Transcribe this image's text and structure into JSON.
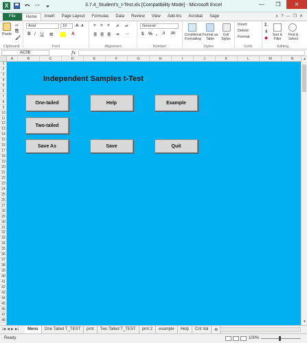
{
  "window": {
    "title": "3.7.4_Student's_t-Test.xls  [Compatibility Mode] - Microsoft Excel",
    "controls": {
      "minimize": "—",
      "maximize": "❐",
      "close": "✕"
    }
  },
  "ribbon": {
    "tabs": [
      "File",
      "Home",
      "Insert",
      "Page Layout",
      "Formulas",
      "Data",
      "Review",
      "View",
      "Add-Ins",
      "Acrobat",
      "Sage"
    ],
    "active_tab": "Home",
    "groups": {
      "clipboard": {
        "label": "Clipboard",
        "paste": "Paste"
      },
      "font": {
        "label": "Font",
        "name": "Arial",
        "size": "10"
      },
      "alignment": {
        "label": "Alignment"
      },
      "number": {
        "label": "Number",
        "format": "General"
      },
      "styles": {
        "label": "Styles",
        "conditional": "Conditional Formatting",
        "format_table": "Format as Table",
        "cell_styles": "Cell Styles"
      },
      "cells": {
        "label": "Cells",
        "insert": "Insert",
        "delete": "Delete",
        "format": "Format"
      },
      "editing": {
        "label": "Editing",
        "sort": "Sort & Filter",
        "find": "Find & Select"
      }
    }
  },
  "formula_bar": {
    "name_box": "AC56",
    "fx": "fx",
    "value": ""
  },
  "grid": {
    "columns": [
      "A",
      "B",
      "C",
      "D",
      "E",
      "F",
      "G",
      "H",
      "I",
      "J",
      "K",
      "L",
      "M",
      "N"
    ],
    "rows": [
      "1",
      "2",
      "3",
      "4",
      "5",
      "6",
      "7",
      "8",
      "9",
      "10",
      "11",
      "12",
      "13",
      "14",
      "15",
      "16",
      "17",
      "18",
      "19",
      "20",
      "21",
      "22",
      "23",
      "24",
      "25",
      "26",
      "27",
      "28",
      "29",
      "30",
      "31",
      "32",
      "33",
      "34",
      "35",
      "36",
      "37",
      "38",
      "39",
      "40",
      "41",
      "42",
      "43",
      "44",
      "45",
      "46",
      "47",
      "48"
    ],
    "title": "Independent Samples t-Test",
    "buttons": {
      "one_tailed": "One-tailed",
      "help": "Help",
      "example": "Example",
      "two_tailed": "Two-tailed",
      "save_as": "Save As",
      "save": "Save",
      "quit": "Quit"
    }
  },
  "sheet_tabs": [
    "Menu",
    "One Tailed T_TEST",
    "prnt",
    "Two Tailed T_TEST",
    "prnt 2",
    "example",
    "Help",
    "Crit Val"
  ],
  "active_sheet": "Menu",
  "status": {
    "text": "Ready",
    "zoom": "100%"
  },
  "colors": {
    "sheet_bg": "#00b0f0",
    "file_tab": "#1e7145",
    "close_button": "#c7382d"
  }
}
